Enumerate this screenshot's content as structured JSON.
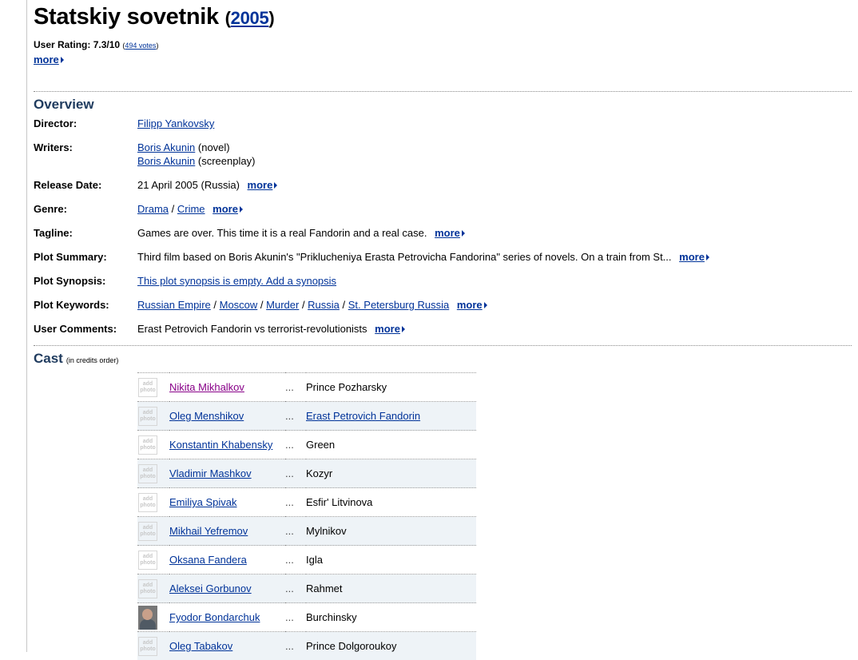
{
  "title": "Statskiy sovetnik",
  "year": "2005",
  "rating": {
    "label": "User Rating:",
    "value": "7.3/10",
    "votes": "494 votes"
  },
  "more_label": "more",
  "sections": {
    "overview": "Overview",
    "cast": "Cast",
    "cast_note": "(in credits order)"
  },
  "overview": {
    "director": {
      "label": "Director:",
      "name": "Filipp Yankovsky"
    },
    "writers": {
      "label": "Writers:",
      "items": [
        {
          "name": "Boris Akunin",
          "role": "(novel)"
        },
        {
          "name": "Boris Akunin",
          "role": "(screenplay)"
        }
      ]
    },
    "release": {
      "label": "Release Date:",
      "value": "21 April 2005 (Russia)"
    },
    "genre": {
      "label": "Genre:",
      "items": [
        "Drama",
        "Crime"
      ]
    },
    "tagline": {
      "label": "Tagline:",
      "value": "Games are over. This time it is a real Fandorin and a real case."
    },
    "plot_summary": {
      "label": "Plot Summary:",
      "value": "Third film based on Boris Akunin's \"Priklucheniya Erasta Petrovicha Fandorina\" series of novels. On a train from St..."
    },
    "plot_synopsis": {
      "label": "Plot Synopsis:",
      "value": "This plot synopsis is empty. Add a synopsis"
    },
    "keywords": {
      "label": "Plot Keywords:",
      "items": [
        "Russian Empire",
        "Moscow",
        "Murder",
        "Russia",
        "St. Petersburg Russia"
      ]
    },
    "comments": {
      "label": "User Comments:",
      "value": "Erast Petrovich Fandorin vs terrorist-revolutionists"
    }
  },
  "cast": {
    "photo_placeholder": "add photo",
    "dots": "...",
    "rows": [
      {
        "actor": "Nikita Mikhalkov",
        "character": "Prince Pozharsky"
      },
      {
        "actor": "Oleg Menshikov",
        "character": "Erast Petrovich Fandorin"
      },
      {
        "actor": "Konstantin Khabensky",
        "character": "Green"
      },
      {
        "actor": "Vladimir Mashkov",
        "character": "Kozyr"
      },
      {
        "actor": "Emiliya Spivak",
        "character": "Esfir' Litvinova"
      },
      {
        "actor": "Mikhail Yefremov",
        "character": "Mylnikov"
      },
      {
        "actor": "Oksana Fandera",
        "character": "Igla"
      },
      {
        "actor": "Aleksei Gorbunov",
        "character": "Rahmet"
      },
      {
        "actor": "Fyodor Bondarchuk",
        "character": "Burchinsky"
      },
      {
        "actor": "Oleg Tabakov",
        "character": "Prince Dolgoroukoy"
      }
    ]
  }
}
